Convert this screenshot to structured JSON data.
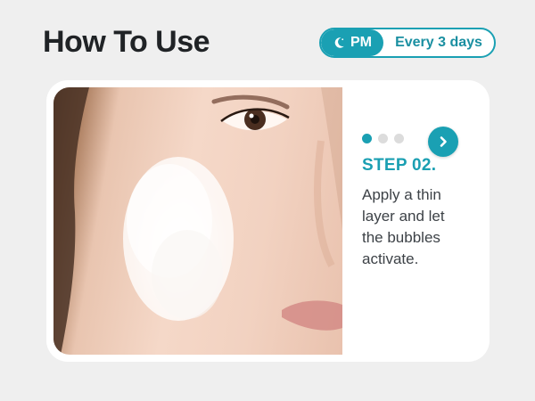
{
  "header": {
    "title": "How To Use",
    "time_badge": {
      "icon": "moon-icon",
      "label": "PM"
    },
    "frequency": "Every 3 days"
  },
  "carousel": {
    "image": {
      "subject": "face-with-foam-icon"
    },
    "dots": {
      "total": 3,
      "active": 0
    },
    "step_label": "STEP 02.",
    "description": "Apply a thin layer and let the bubbles activate.",
    "next_button_icon": "chevron-right-icon"
  },
  "colors": {
    "accent": "#1aa0b3",
    "background": "#efefef",
    "card": "#ffffff",
    "title": "#202326",
    "inactive_dot": "#dcdcdc"
  }
}
